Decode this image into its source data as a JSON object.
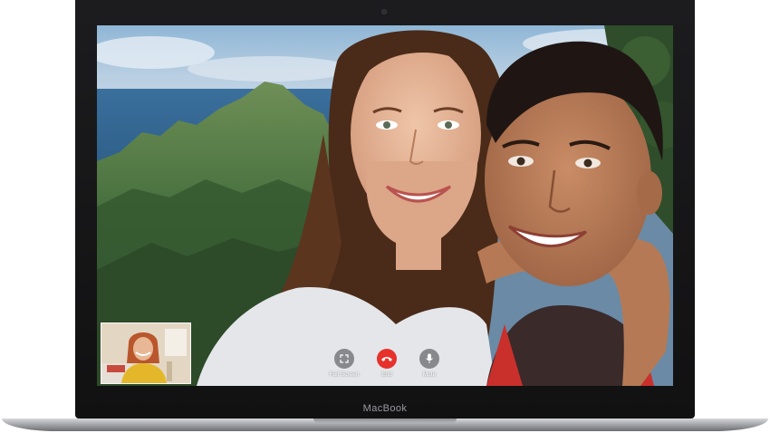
{
  "device": {
    "brand_label": "MacBook"
  },
  "facetime": {
    "controls": [
      {
        "id": "fullscreen",
        "label": "Full Screen",
        "icon": "fullscreen-icon"
      },
      {
        "id": "end",
        "label": "End",
        "icon": "end-call-icon",
        "color": "#e7312b"
      },
      {
        "id": "mute",
        "label": "Mute",
        "icon": "microphone-icon"
      }
    ]
  }
}
